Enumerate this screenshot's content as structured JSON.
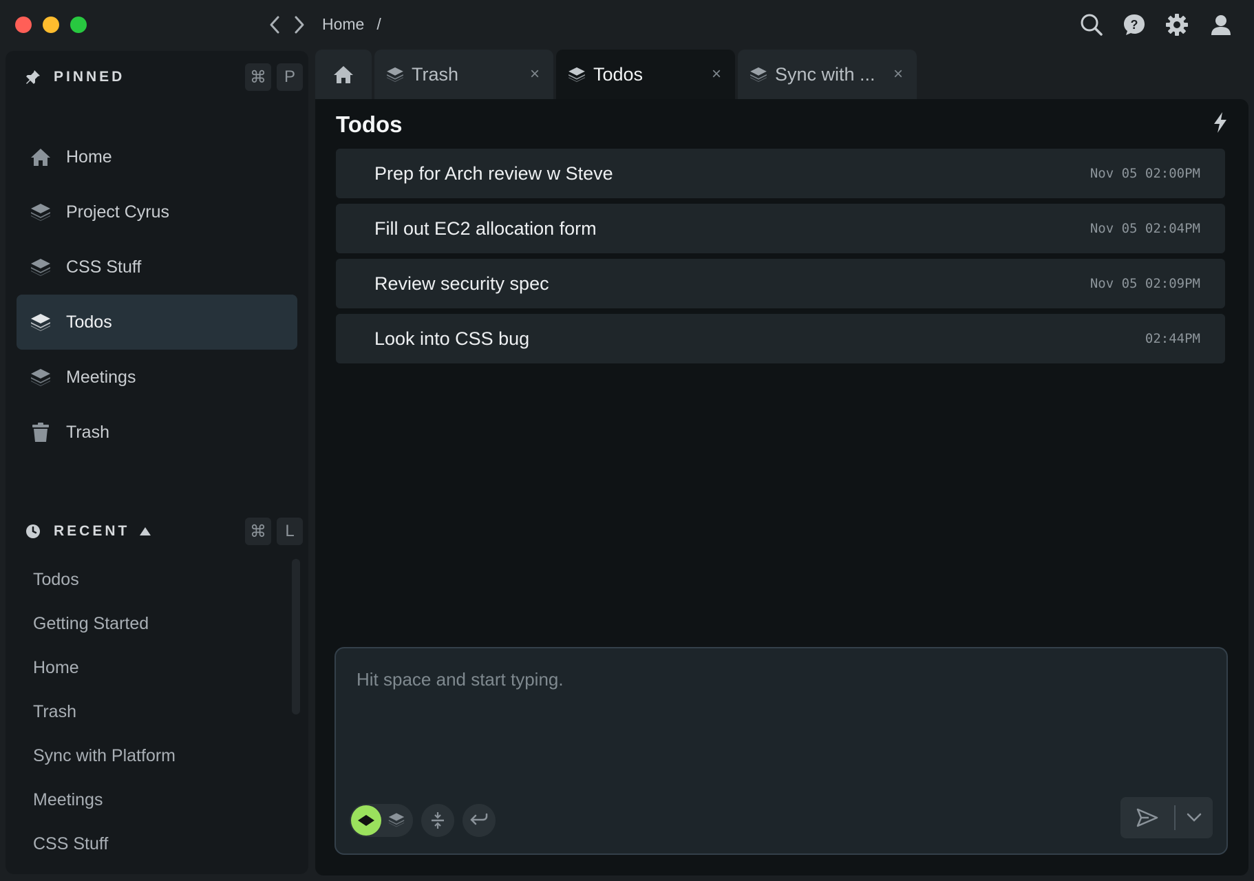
{
  "window": {
    "breadcrumb": [
      "Home",
      "/"
    ]
  },
  "topbar": {
    "icons": [
      "search-icon",
      "help-icon",
      "gear-icon",
      "user-icon"
    ]
  },
  "sidebar": {
    "pinned": {
      "title": "PINNED",
      "shortcut": [
        "⌘",
        "P"
      ],
      "items": [
        {
          "label": "Home",
          "icon": "home-icon"
        },
        {
          "label": "Project Cyrus",
          "icon": "layers-icon"
        },
        {
          "label": "CSS Stuff",
          "icon": "layers-icon"
        },
        {
          "label": "Todos",
          "icon": "layers-icon",
          "active": true
        },
        {
          "label": "Meetings",
          "icon": "layers-icon"
        },
        {
          "label": "Trash",
          "icon": "trash-icon"
        }
      ]
    },
    "recent": {
      "title": "RECENT",
      "shortcut": [
        "⌘",
        "L"
      ],
      "items": [
        "Todos",
        "Getting Started",
        "Home",
        "Trash",
        "Sync with Platform",
        "Meetings",
        "CSS Stuff"
      ]
    }
  },
  "tabs": [
    {
      "label": "Trash",
      "close": "×"
    },
    {
      "label": "Todos",
      "close": "×",
      "active": true
    },
    {
      "label": "Sync with ...",
      "close": "×"
    }
  ],
  "main": {
    "title": "Todos",
    "todos": [
      {
        "text": "Prep for Arch review w Steve",
        "time": "Nov 05 02:00PM"
      },
      {
        "text": "Fill out EC2 allocation form",
        "time": "Nov 05 02:04PM"
      },
      {
        "text": "Review security spec",
        "time": "Nov 05 02:09PM"
      },
      {
        "text": "Look into CSS bug",
        "time": "02:44PM"
      }
    ],
    "composer": {
      "placeholder": "Hit space and start typing."
    }
  },
  "colors": {
    "accent_green": "#9be15d",
    "active_item_bg": "#26323a",
    "background": "#1b1f22"
  }
}
